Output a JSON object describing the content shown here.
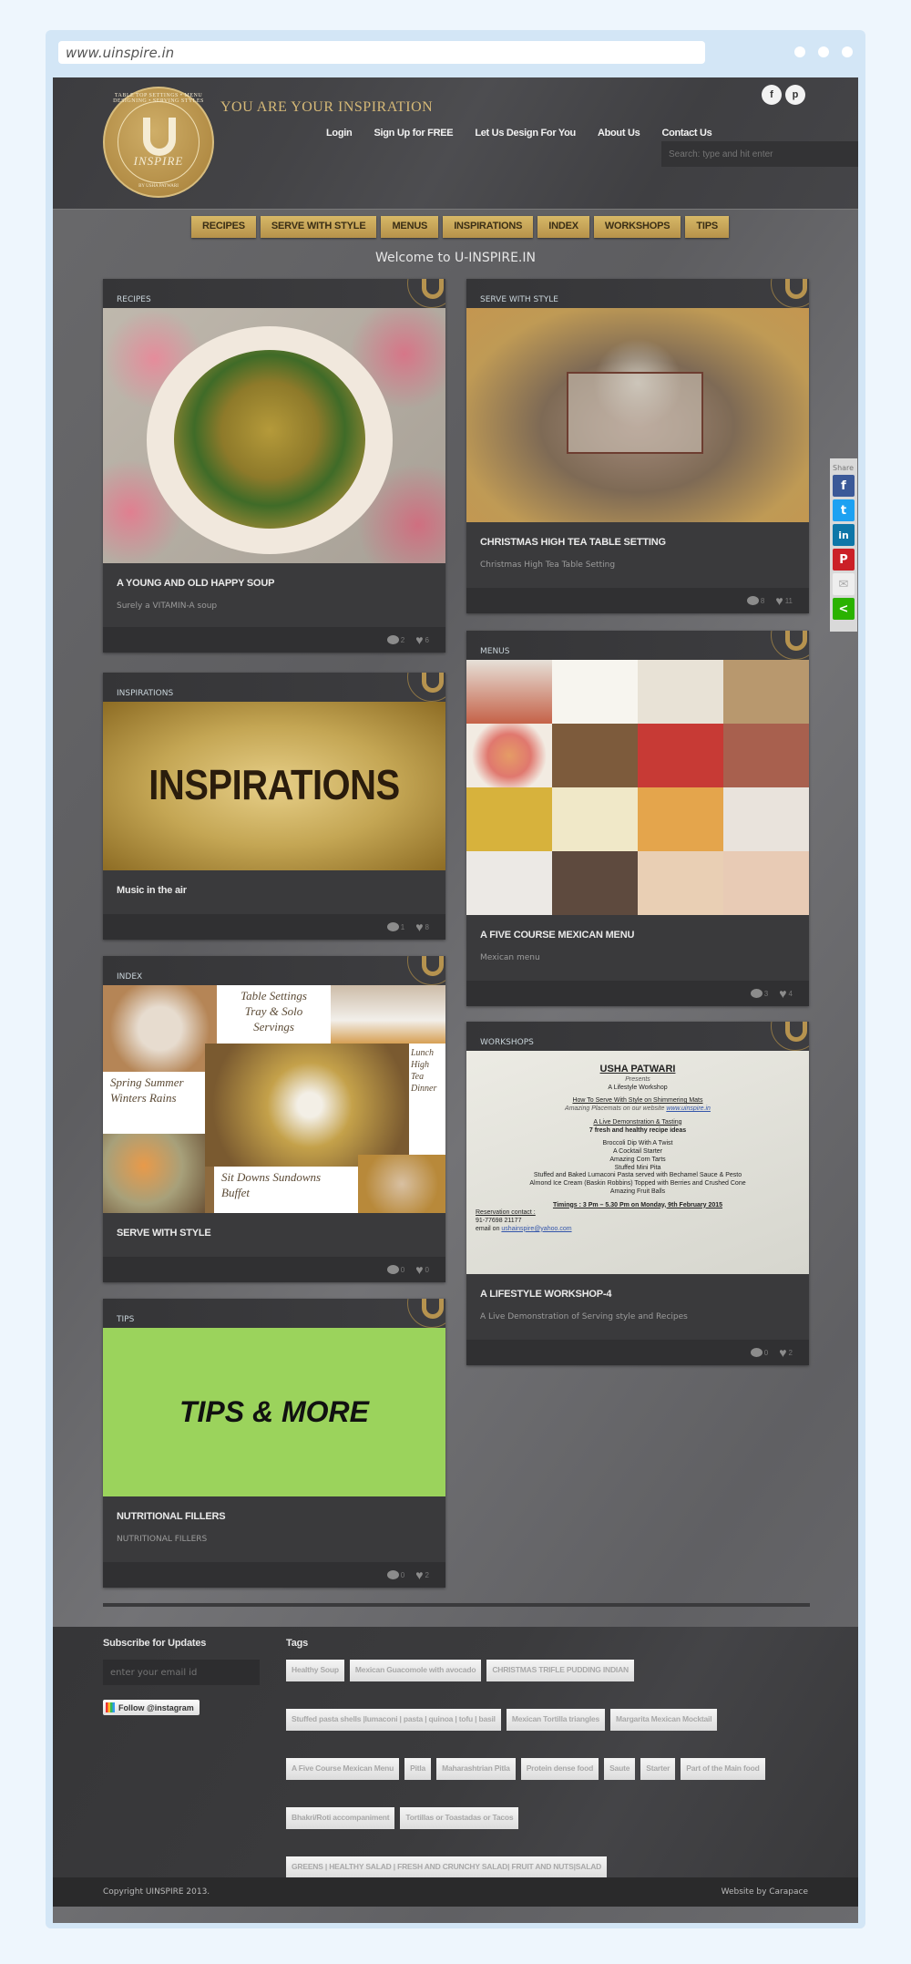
{
  "browser": {
    "url": "www.uinspire.in"
  },
  "header": {
    "logo": {
      "name": "INSPIRE",
      "arc_text": "TABLE TOP SETTINGS • MENU DESIGNING • SERVING STYLES",
      "by_text": "BY USHA PATWARI"
    },
    "tagline": "YOU ARE YOUR INSPIRATION",
    "top_nav": [
      "Login",
      "Sign Up for FREE",
      "Let Us Design For You",
      "About Us",
      "Contact Us"
    ],
    "social": [
      {
        "icon": "facebook-icon",
        "glyph": "f"
      },
      {
        "icon": "pinterest-icon",
        "glyph": "p"
      }
    ],
    "search_placeholder": "Search: type and hit enter"
  },
  "category_nav": [
    "RECIPES",
    "SERVE WITH STYLE",
    "MENUS",
    "INSPIRATIONS",
    "INDEX",
    "WORKSHOPS",
    "TIPS"
  ],
  "welcome": "Welcome to U-INSPIRE.IN",
  "cards": {
    "recipes": {
      "category": "RECIPES",
      "title": "A YOUNG AND OLD HAPPY SOUP",
      "description": "Surely a VITAMIN-A soup",
      "comments": "2",
      "likes": "6"
    },
    "serve": {
      "category": "SERVE WITH STYLE",
      "title": "CHRISTMAS HIGH TEA TABLE SETTING",
      "description": "Christmas High Tea Table Setting",
      "comments": "8",
      "likes": "11"
    },
    "inspirations": {
      "category": "INSPIRATIONS",
      "image_text": "INSPIRATIONS",
      "title": "Music in the air",
      "description": "",
      "comments": "1",
      "likes": "8"
    },
    "menus": {
      "category": "MENUS",
      "title": "A FIVE COURSE MEXICAN MENU",
      "description": "Mexican menu",
      "comments": "3",
      "likes": "4"
    },
    "index": {
      "category": "INDEX",
      "image_words": {
        "table": "Table Settings\nTray & Solo\nServings",
        "seasons": "Spring  Summer\nWinters  Rains",
        "meals": "Lunch\nHigh\nTea\nDinner",
        "sitdowns": "Sit Downs  Sundowns\nBuffet"
      },
      "title": "SERVE WITH STYLE",
      "description": "",
      "comments": "0",
      "likes": "0"
    },
    "workshops": {
      "category": "WORKSHOPS",
      "flyer": {
        "heading": "USHA PATWARI",
        "presents": "Presents",
        "workshop": "A Lifestyle Workshop",
        "line1": "How To Serve With Style on Shimmering Mats",
        "line2_prefix": "Amazing Placemats on our website ",
        "line2_link": "www.uinspire.in",
        "demo": "A Live Demonstration & Tasting",
        "ideas": "7 fresh and healthy recipe ideas",
        "items": [
          "Broccoli Dip With A Twist",
          "A Cocktail Starter",
          "Amazing Corn Tarts",
          "Stuffed Mini Pita",
          "Stuffed and Baked Lumaconi Pasta served with Bechamel Sauce & Pesto",
          "Almond Ice Cream (Baskin Robbins) Topped with Berries and Crushed Cone",
          "Amazing Fruit Balls"
        ],
        "timings": "Timings : 3 Pm – 5.30 Pm on Monday, 9th February 2015",
        "reservation": "Reservation contact :",
        "phone": "91-77698 21177",
        "email_prefix": "email on ",
        "email": "ushainspire@yahoo.com"
      },
      "title": "A LIFESTYLE WORKSHOP-4",
      "description": "A Live Demonstration of Serving style and Recipes",
      "comments": "0",
      "likes": "2"
    },
    "tips": {
      "category": "TIPS",
      "image_text": "TIPS & MORE",
      "title": "NUTRITIONAL FILLERS",
      "description": "NUTRITIONAL FILLERS",
      "comments": "0",
      "likes": "2"
    }
  },
  "share_bar": {
    "label": "Share",
    "buttons": [
      {
        "name": "facebook",
        "glyph": "f",
        "color": "#3b5998"
      },
      {
        "name": "twitter",
        "glyph": "t",
        "color": "#1da1f2"
      },
      {
        "name": "linkedin",
        "glyph": "in",
        "color": "#0e76a8"
      },
      {
        "name": "pinterest",
        "glyph": "P",
        "color": "#cb2027"
      },
      {
        "name": "email",
        "glyph": "✉",
        "color": "#eeeeee"
      },
      {
        "name": "share",
        "glyph": "<",
        "color": "#2ab200"
      }
    ]
  },
  "footer": {
    "subscribe_heading": "Subscribe for Updates",
    "email_placeholder": "enter your email id",
    "instagram_label": "Follow @instagram",
    "tags_heading": "Tags",
    "tags": [
      "Healthy Soup",
      "Mexican Guacomole with avocado",
      "CHRISTMAS TRIFLE PUDDING INDIAN",
      "Stuffed pasta shells |lumaconi | pasta | quinoa | tofu | basil",
      "Mexican Tortilla triangles",
      "Margarita Mexican Mocktail",
      "A Five Course Mexican Menu",
      "Pitla",
      "Maharashtrian Pitla",
      "Protein dense food",
      "Saute",
      "Starter",
      "Part of the Main food",
      "Bhakri/Roti accompaniment",
      "Tortillas or Toastadas or Tacos",
      "GREENS | HEALTHY SALAD | FRESH AND CRUNCHY SALAD| FRUIT AND NUTS|SALAD"
    ],
    "copyright": "Copyright UINSPIRE 2013.",
    "credit": "Website by Carapace"
  }
}
